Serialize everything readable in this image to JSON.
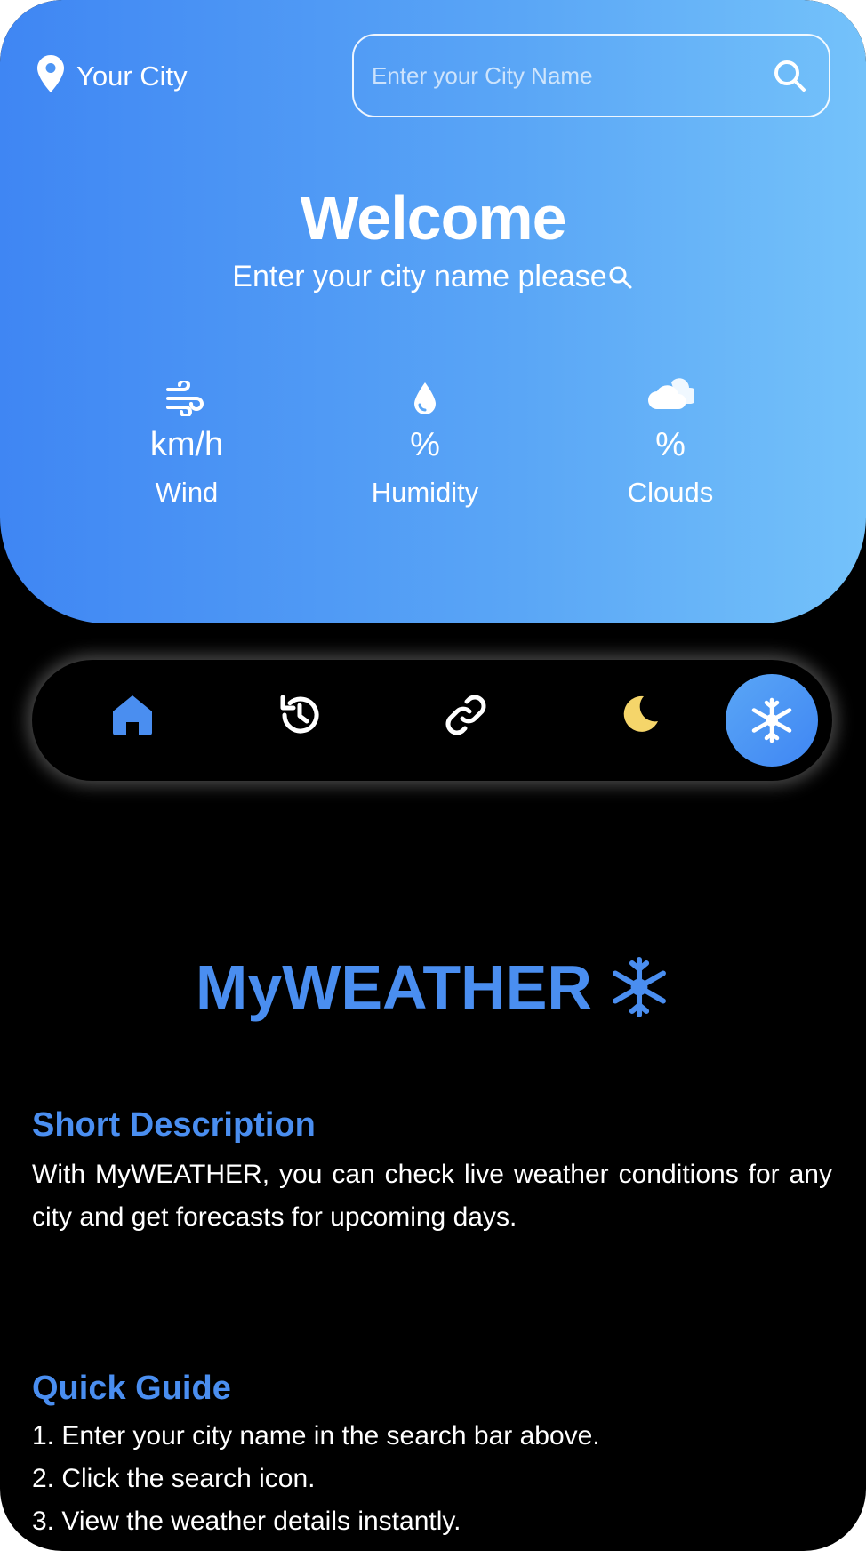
{
  "header": {
    "location_label": "Your City",
    "search_placeholder": "Enter your City Name",
    "welcome": "Welcome",
    "subtitle": "Enter your city name please"
  },
  "stats": [
    {
      "value": "km/h",
      "label": "Wind",
      "icon": "wind-icon"
    },
    {
      "value": "%",
      "label": "Humidity",
      "icon": "droplet-icon"
    },
    {
      "value": "%",
      "label": "Clouds",
      "icon": "cloud-icon"
    }
  ],
  "nav": {
    "items": [
      {
        "name": "home",
        "icon": "home-icon"
      },
      {
        "name": "history",
        "icon": "history-icon"
      },
      {
        "name": "link",
        "icon": "link-icon"
      },
      {
        "name": "theme",
        "icon": "moon-icon"
      },
      {
        "name": "snow",
        "icon": "snowflake-icon",
        "active": true
      }
    ]
  },
  "app": {
    "title": "MyWEATHER"
  },
  "description": {
    "heading": "Short Description",
    "text": "With MyWEATHER, you can check live weather conditions for any city and get forecasts for upcoming days."
  },
  "guide": {
    "heading": "Quick Guide",
    "steps": [
      "1. Enter your city name in the search bar above.",
      "2. Click the search icon.",
      "3. View the weather details instantly."
    ]
  },
  "colors": {
    "accent": "#4a8ef0",
    "gradient_start": "#3f86f3",
    "gradient_end": "#74c2fa",
    "moon": "#f5d56a"
  }
}
